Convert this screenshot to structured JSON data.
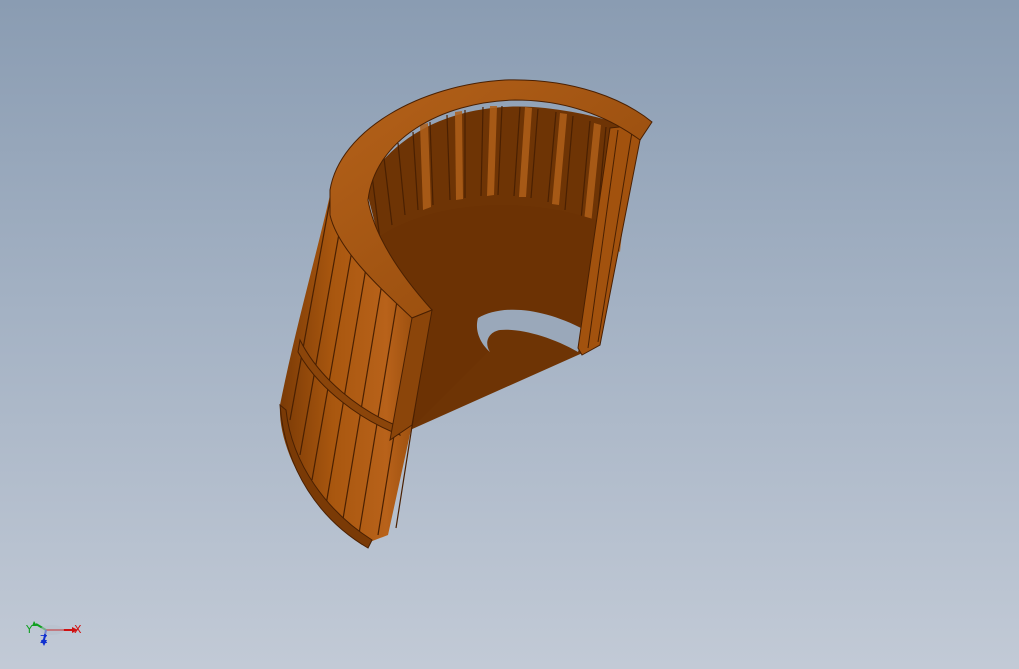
{
  "viewport": {
    "background_top": "#8a9cb2",
    "background_bottom": "#c2cad6"
  },
  "model": {
    "name": "impeller-section",
    "color": "#9b4d0c"
  },
  "triad": {
    "x_label": "X",
    "y_label": "Y",
    "z_label": "Z",
    "x_color": "#d01010",
    "y_color": "#10a020",
    "z_color": "#1030d0"
  }
}
